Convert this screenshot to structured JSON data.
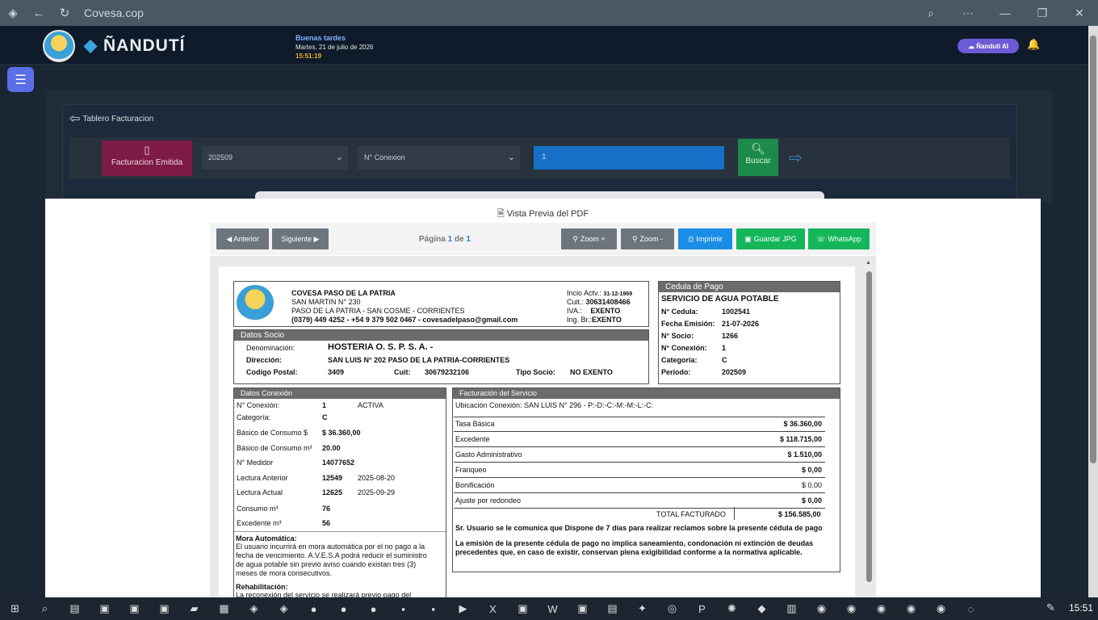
{
  "browser": {
    "url": "Covesa.cop"
  },
  "header": {
    "brand": "ÑANDUTÍ",
    "greeting": "Buenas tardes",
    "date": "Martes, 21 de julio de 2026",
    "time": "15:51:19",
    "ai_button": "Ñanduti AI"
  },
  "card": {
    "title": "Tablero Facturacion"
  },
  "filters": {
    "emitida_label": "Facturacion Emitida",
    "period_value": "202509",
    "conexion_value": "N° Conexion",
    "search_value": "1",
    "buscar_label": "Buscar"
  },
  "modal": {
    "title": "Vista Previa del PDF",
    "prev": "◀ Anterior",
    "next": "Siguiente ▶",
    "page_label": "Página",
    "page_current": "1",
    "page_of": "de",
    "page_total": "1",
    "zoom_in": "Zoom +",
    "zoom_out": "Zoom -",
    "print": "Imprimir",
    "save_jpg": "Guardar JPG",
    "whatsapp": "WhatsApp"
  },
  "doc": {
    "company": "COVESA PASO DE LA PATRIA",
    "addr1": "SAN MARTIN N° 230",
    "addr2": "PASO DE LA PATRIA - SAN COSME - CORRIENTES",
    "contact": "(0379) 449 4252 - +54 9 379 502 0467 - covesadelpaso@gmail.com",
    "inicio_label": "Incio Actv.:",
    "inicio_value": "31-12-1969",
    "cuit_label": "Cuit.:",
    "cuit_value": "30631408466",
    "iva_label": "IVA.:",
    "iva_value": "EXENTO",
    "ingbr_label": "Ing. Br.:",
    "ingbr_value": "EXENTO",
    "cedula_title": "Cedula de Pago",
    "servicio": "SERVICIO DE AGUA POTABLE",
    "cedula_rows": [
      {
        "label": "N° Cedula:",
        "value": "1002541"
      },
      {
        "label": "Fecha Emisión:",
        "value": "21-07-2026"
      },
      {
        "label": "N° Socio:",
        "value": "1266"
      },
      {
        "label": "N° Conexión:",
        "value": "1"
      },
      {
        "label": "Categoría:",
        "value": "C"
      },
      {
        "label": "Período:",
        "value": "202509"
      }
    ],
    "socio_title": "Datos Socio",
    "denom_label": "Denominación:",
    "denom_value": "HOSTERIA O. S. P. S. A. -",
    "dir_label": "Dirección:",
    "dir_value": "SAN LUIS N° 202  PASO DE LA PATRIA-CORRIENTES",
    "cp_label": "Codigo Postal:",
    "cp_value": "3409",
    "socio_cuit_label": "Cuit:",
    "socio_cuit_value": "30679232106",
    "tipo_label": "Tipo Socio:",
    "tipo_value": "NO EXENTO",
    "conexion_title": "Datos Conexión",
    "conexion_rows": [
      {
        "label": "N° Conexión:",
        "value": "1",
        "extra": "ACTIVA"
      },
      {
        "label": "Categoría:",
        "value": "C",
        "extra": ""
      },
      {
        "label": "Básico de Consumo $",
        "value": "$ 36.360,00",
        "extra": ""
      },
      {
        "label": "Básico de Consumo m³",
        "value": "20.00",
        "extra": ""
      },
      {
        "label": "N° Medidor",
        "value": "14077652",
        "extra": ""
      },
      {
        "label": "Lectura Anterior",
        "value": "12549",
        "extra": "2025-08-20"
      },
      {
        "label": "Lectura Actual",
        "value": "12625",
        "extra": "2025-09-29"
      },
      {
        "label": "Consumo m³",
        "value": "76",
        "extra": ""
      },
      {
        "label": "Excedente m³",
        "value": "56",
        "extra": ""
      }
    ],
    "mora_title": "Mora Automática:",
    "mora_text": [
      "El usuario incurrirá en mora automática por el no pago a la",
      "fecha de vencimiento. A.V.E.S.A podrá reducir el suministro",
      "de agua potable sin previo aviso cuando existan tres (3)",
      "meses de mora consecutivos."
    ],
    "rehab_title": "Rehabilitación:",
    "rehab_text": "La reconexión del servicio se realizará previo pago del",
    "fact_title": "Facturación del Servicio",
    "ubicacion": "Ubicación Conexión:  SAN LUIS N° 296 - P:-D:-C:-M:-M:-L:-C:",
    "fact_rows": [
      {
        "label": "Tasa Básica",
        "value": "$ 36.360,00"
      },
      {
        "label": "Excedente",
        "value": "$ 118.715,00"
      },
      {
        "label": "Gasto Administrativo",
        "value": "$ 1.510,00"
      },
      {
        "label": "Franqueo",
        "value": "$ 0,00"
      },
      {
        "label": "Bonificación",
        "value": "$ 0,00"
      },
      {
        "label": "Ajuste por redondeo",
        "value": "$ 0,00"
      }
    ],
    "total_label": "TOTAL FACTURADO",
    "total_value": "$ 156.585,00",
    "notice1": "Sr. Usuario se le comunica que Dispone de 7 días para realizar reclamos sobre la presente cédula de pago",
    "notice2a": "La emisión de la presente cédula de pago no implica saneamiento, condonación ni extinción de deudas",
    "notice2b": "precedentes que, en caso de existir, conservan plena exigibilidad conforme a la normativa aplicable."
  },
  "taskbar": {
    "clock": "15:51"
  }
}
